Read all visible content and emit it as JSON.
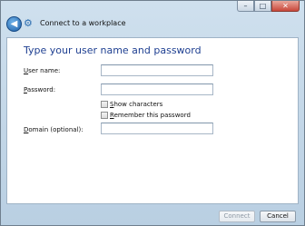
{
  "window": {
    "title": "Connect to a workplace",
    "back_icon": "back-arrow-icon",
    "app_icon": "workplace-connection-icon",
    "controls": {
      "minimize": "–",
      "maximize": "□",
      "close": "✕"
    }
  },
  "content": {
    "heading": "Type your user name and password",
    "username": {
      "label_pre": "",
      "label_accel": "U",
      "label_post": "ser name:",
      "value": "",
      "placeholder": ""
    },
    "password": {
      "label_pre": "",
      "label_accel": "P",
      "label_post": "assword:",
      "value": "",
      "placeholder": ""
    },
    "show_characters": {
      "label_pre": "",
      "label_accel": "S",
      "label_post": "how characters",
      "checked": false
    },
    "remember_password": {
      "label_pre": "",
      "label_accel": "R",
      "label_post": "emember this password",
      "checked": false
    },
    "domain": {
      "label_pre": "",
      "label_accel": "D",
      "label_post": "omain (optional):",
      "value": "",
      "placeholder": ""
    }
  },
  "footer": {
    "connect_label": "Connect",
    "cancel_label": "Cancel"
  },
  "colors": {
    "heading": "#1e3f91",
    "chrome": "#c3d7e9"
  }
}
